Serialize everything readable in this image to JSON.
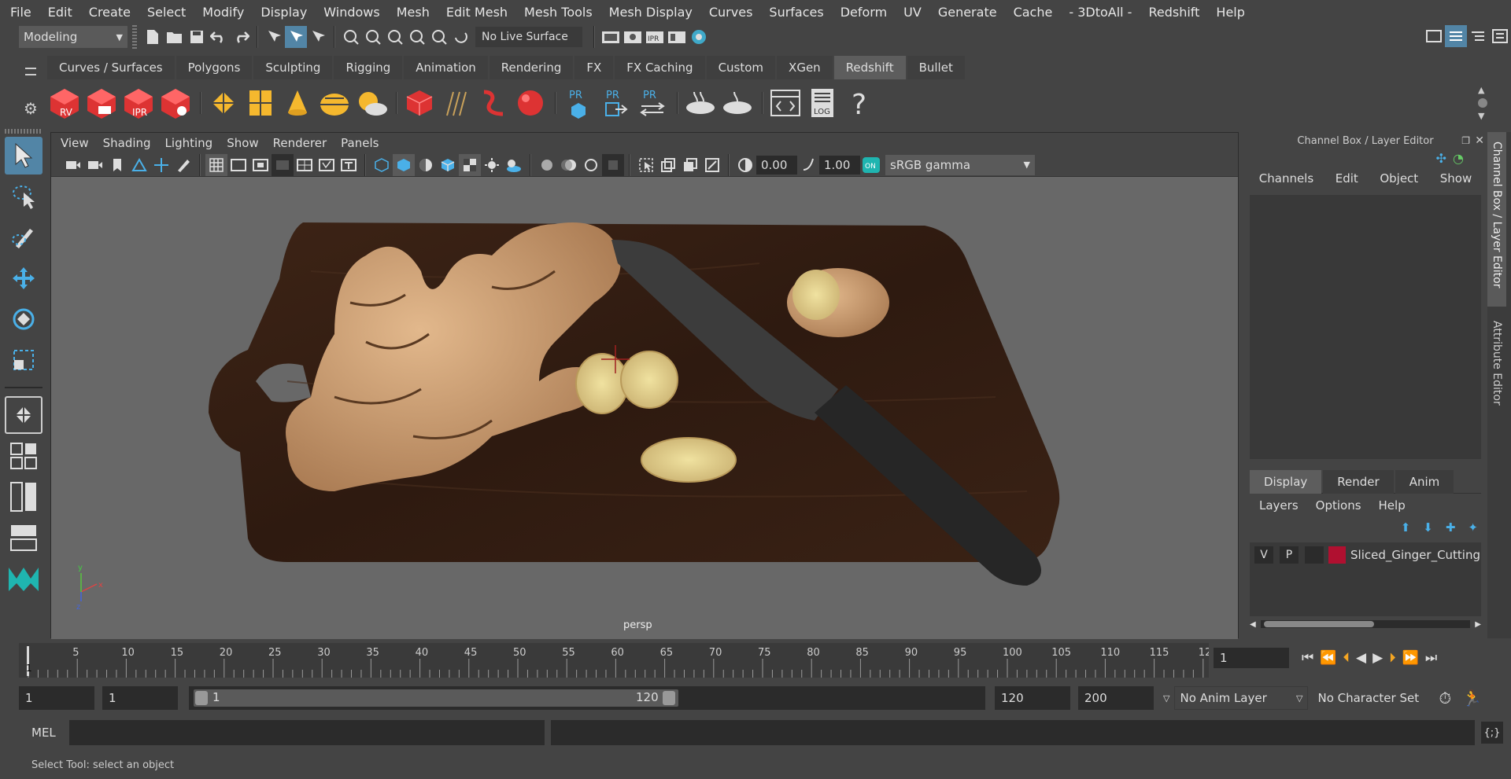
{
  "menu": [
    "File",
    "Edit",
    "Create",
    "Select",
    "Modify",
    "Display",
    "Windows",
    "Mesh",
    "Edit Mesh",
    "Mesh Tools",
    "Mesh Display",
    "Curves",
    "Surfaces",
    "Deform",
    "UV",
    "Generate",
    "Cache",
    "- 3DtoAll -",
    "Redshift",
    "Help"
  ],
  "status": {
    "mode": "Modeling",
    "live_surface": "No Live Surface"
  },
  "shelf": {
    "tabs": [
      "Curves / Surfaces",
      "Polygons",
      "Sculpting",
      "Rigging",
      "Animation",
      "Rendering",
      "FX",
      "FX Caching",
      "Custom",
      "XGen",
      "Redshift",
      "Bullet"
    ],
    "active_tab": "Redshift",
    "rs_labels": [
      "RV",
      "",
      "IPR",
      ""
    ],
    "pr_label": "PR",
    "log_label": "LOG",
    "help_glyph": "?"
  },
  "viewport": {
    "menu": [
      "View",
      "Shading",
      "Lighting",
      "Show",
      "Renderer",
      "Panels"
    ],
    "exposure": "0.00",
    "gamma": "1.00",
    "color_space": "sRGB gamma",
    "camera": "persp",
    "axis_x": "x",
    "axis_y": "y",
    "axis_z": "z"
  },
  "channelbox": {
    "title": "Channel Box / Layer Editor",
    "menu": [
      "Channels",
      "Edit",
      "Object",
      "Show"
    ],
    "layer_tabs": [
      "Display",
      "Render",
      "Anim"
    ],
    "active_layer_tab": "Display",
    "layer_menu": [
      "Layers",
      "Options",
      "Help"
    ],
    "layer": {
      "v": "V",
      "p": "P",
      "name": "Sliced_Ginger_Cutting",
      "color": "#b01030"
    }
  },
  "side_tabs": [
    "Channel Box / Layer Editor",
    "Attribute Editor"
  ],
  "timeline": {
    "ticks": [
      "5",
      "10",
      "15",
      "20",
      "25",
      "30",
      "35",
      "40",
      "45",
      "50",
      "55",
      "60",
      "65",
      "70",
      "75",
      "80",
      "85",
      "90",
      "95",
      "100",
      "105",
      "110",
      "115",
      "12"
    ],
    "first": "1",
    "current_frame": "1"
  },
  "range": {
    "start": "1",
    "playback_start": "1",
    "slider_start": "1",
    "slider_end": "120",
    "playback_end": "120",
    "end": "200",
    "anim_layer": "No Anim Layer",
    "character_set": "No Character Set"
  },
  "mel": {
    "label": "MEL"
  },
  "helpline": "Select Tool: select an object"
}
